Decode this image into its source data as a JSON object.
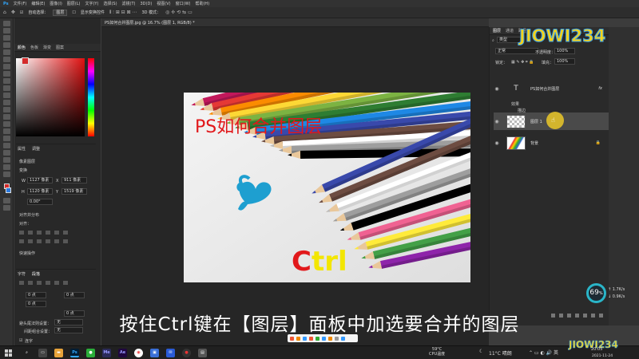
{
  "menubar": {
    "items": [
      "文件(F)",
      "编辑(E)",
      "图像(I)",
      "图层(L)",
      "文字(Y)",
      "选择(S)",
      "滤镜(T)",
      "3D(D)",
      "视图(V)",
      "窗口(W)",
      "帮助(H)"
    ]
  },
  "options": {
    "auto_select_label": "自动选择：",
    "auto_select_value": "图层",
    "show_transform_label": "显示变换控件",
    "mode_3d_label": "3D 模式："
  },
  "document": {
    "tab_title": "PS如何合并图层.jpg @ 16.7% (图层 1, RGB/8) *",
    "image_title": "PS如何合并图层",
    "ctrl_first": "C",
    "ctrl_rest": "trl"
  },
  "left_panel": {
    "color_tabs": [
      "颜色",
      "色板",
      "渐变",
      "图案"
    ],
    "properties_tabs": [
      "属性",
      "调整"
    ],
    "layer_type": "像素图层",
    "transform_label": "变换",
    "w_value": "1127 像素",
    "x_value": "911 像素",
    "h_value": "1120 像素",
    "y_value": "1519 像素",
    "angle_value": "0.00°",
    "align_label": "对齐并分布",
    "align_sub": "对齐：",
    "quick_actions": "快速操作",
    "char_tabs": [
      "字符",
      "段落"
    ],
    "indent1": "0 点",
    "indent2": "0 点",
    "space1": "0 点",
    "space2": "0 点",
    "avoid_label": "避头尾法则设置：",
    "avoid_value": "无",
    "spacing_label": "间距组合设置：",
    "spacing_value": "无",
    "hyphen_label": "连字"
  },
  "layers_panel": {
    "tabs": [
      "图层",
      "通道",
      "路径"
    ],
    "filter_label": "类型",
    "blend_mode": "正常",
    "opacity_label": "不透明度：",
    "opacity_value": "100%",
    "lock_label": "锁定：",
    "fill_label": "填充：",
    "fill_value": "100%",
    "layers": [
      {
        "name": "PS如何合并图层",
        "kind": "T"
      },
      {
        "name": "效果",
        "kind": "effects"
      },
      {
        "name": "描边",
        "kind": "effect"
      },
      {
        "name": "图层 1",
        "kind": "pixel"
      },
      {
        "name": "背景",
        "kind": "background"
      }
    ]
  },
  "overlay": {
    "logo": "JIOWI234",
    "subtitle": "按住Ctrl键在【图层】面板中加选要合并的图层"
  },
  "cpu_widget": {
    "percent": "69",
    "unit": "%",
    "up": "1.7K/s",
    "down": "0.9K/s"
  },
  "taskbar": {
    "weather_top": "59°C",
    "weather_bottom": "CPU温度",
    "temp": "11°C 晴朗",
    "time": "20:05",
    "date": "2021-11-24"
  },
  "colors": {
    "accent_red": "#e1181b",
    "ctrl_yellow": "#f3e600",
    "logo_yellow": "#f6d31a",
    "logo_blue": "#3aa0e8"
  }
}
